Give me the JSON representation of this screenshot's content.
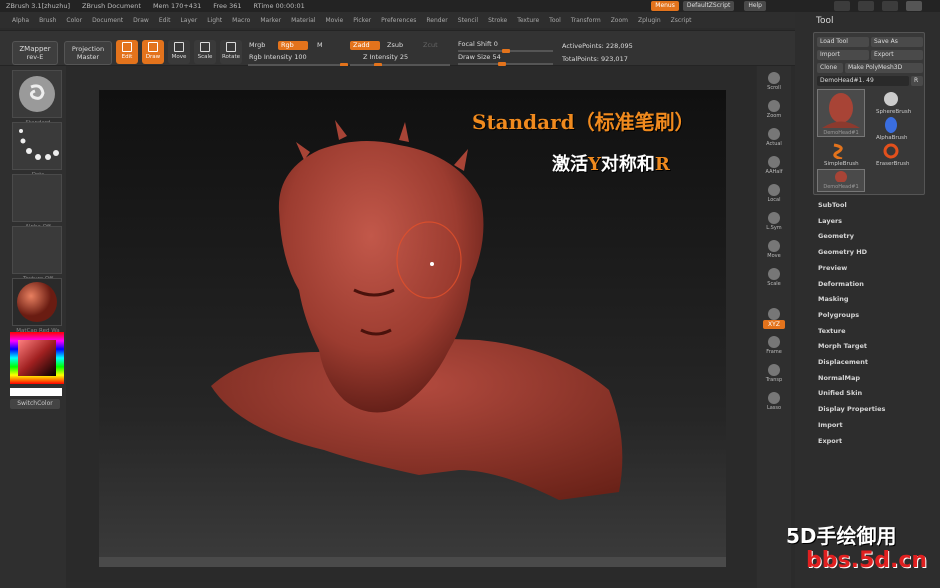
{
  "title_bar": {
    "app": "ZBrush 3.1[zhuzhu]",
    "document": "ZBrush Document",
    "mem": "Mem 170+431",
    "free": "Free 361",
    "rtime": "RTime 00:00:01",
    "menus_btn": "Menus",
    "script_btn": "DefaultZScript",
    "help_btn": "Help"
  },
  "menus": [
    "Alpha",
    "Brush",
    "Color",
    "Document",
    "Draw",
    "Edit",
    "Layer",
    "Light",
    "Macro",
    "Marker",
    "Material",
    "Movie",
    "Picker",
    "Preferences",
    "Render",
    "Stencil",
    "Stroke",
    "Texture",
    "Tool",
    "Transform",
    "Zoom",
    "Zplugin",
    "Zscript"
  ],
  "toolbar": {
    "zmapper": "ZMapper",
    "zmapper_sub": "rev-E",
    "projection": "Projection",
    "projection_sub": "Master",
    "edit": "Edit",
    "draw": "Draw",
    "move": "Move",
    "scale": "Scale",
    "rotate": "Rotate",
    "mrgb": "Mrgb",
    "rgb": "Rgb",
    "m": "M",
    "rgb_intensity": "Rgb Intensity 100",
    "zadd": "Zadd",
    "zsub": "Zsub",
    "zcut": "Zcut",
    "z_intensity": "Z Intensity 25",
    "focal_shift": "Focal Shift 0",
    "draw_size": "Draw Size 54",
    "active_points": "ActivePoints: 228,095",
    "total_points": "TotalPoints: 923,017"
  },
  "left_shelf": {
    "items": [
      "Standard",
      "Dots",
      "Alpha Off",
      "Texture Off",
      "MatCap Red Wa"
    ],
    "switch_color": "SwitchColor"
  },
  "right_shelf": [
    "Scroll",
    "Zoom",
    "Actual",
    "AAHalf",
    "Local",
    "L.Sym",
    "Move",
    "Scale",
    "Rotate",
    "Frame",
    "Transp",
    "Lasso"
  ],
  "right_shelf_xyz": "XYZ",
  "tool_palette": {
    "title": "Tool",
    "load_tool": "Load Tool",
    "save_as": "Save As",
    "import": "Import",
    "export": "Export",
    "clone": "Clone",
    "make_polymesh": "Make PolyMesh3D",
    "current_tool": "DemoHead#1. 49",
    "r_btn": "R",
    "thumbs": [
      "DemoHead#1",
      "SphereBrush",
      "AlphaBrush",
      "SimpleBrush",
      "EraserBrush",
      "DemoHead#1"
    ],
    "subpalettes": [
      "SubTool",
      "Layers",
      "Geometry",
      "Geometry HD",
      "Preview",
      "Deformation",
      "Masking",
      "Polygroups",
      "Texture",
      "Morph Target",
      "Displacement",
      "NormalMap",
      "Unified Skin",
      "Display Properties",
      "Import",
      "Export"
    ]
  },
  "overlay": {
    "line1": "Standard（标准笔刷）",
    "line2_a": "激活",
    "line2_b": "Y",
    "line2_c": "对称和",
    "line2_d": "R"
  },
  "watermark": {
    "line1": "5D手绘御用",
    "line2": "bbs.5d.cn"
  },
  "colors": {
    "accent": "#e3731c",
    "bust": "#a8463a"
  }
}
